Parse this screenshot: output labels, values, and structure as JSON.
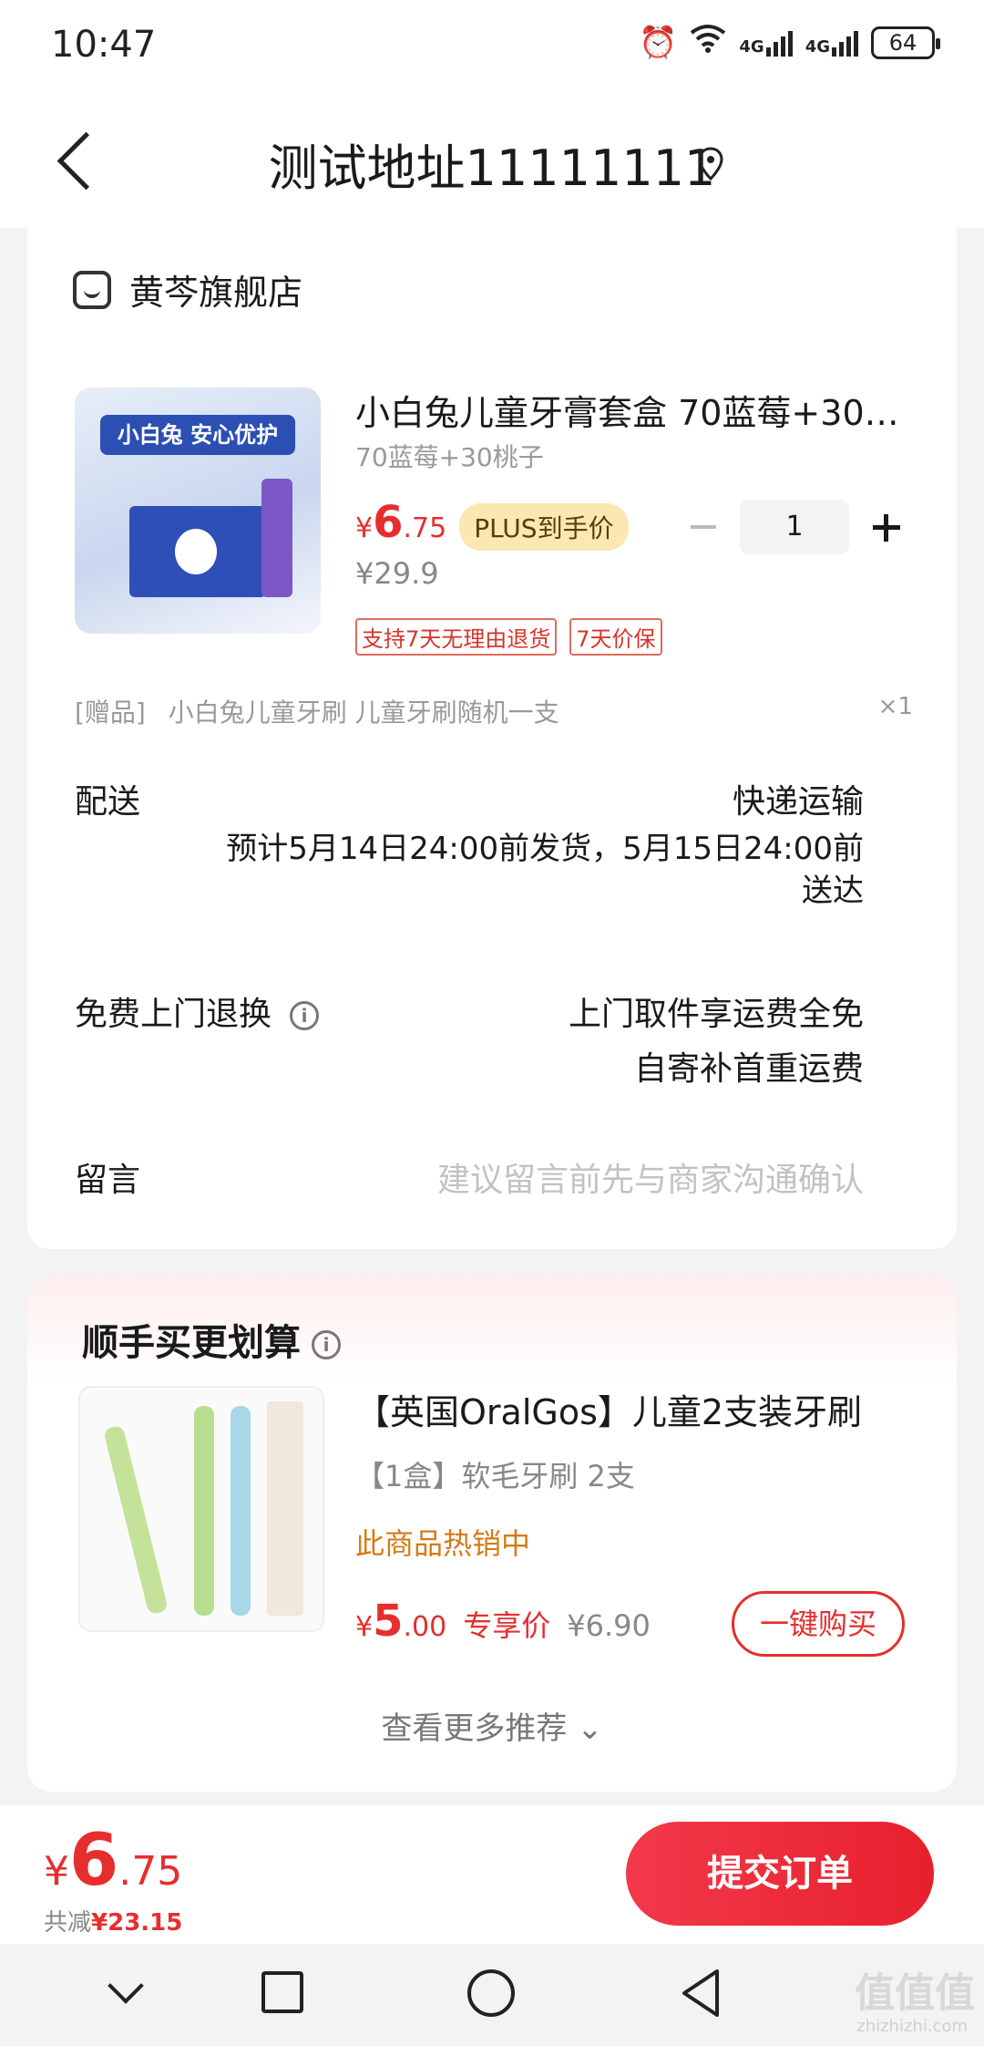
{
  "status_bar": {
    "time": "10:47",
    "network1": "4G",
    "network2": "4G",
    "battery": "64"
  },
  "header": {
    "title": "测试地址11111111"
  },
  "store": {
    "name": "黄芩旗舰店"
  },
  "product": {
    "image_banner": "小白兔 安心优护",
    "title": "小白兔儿童牙膏套盒 70蓝莓+30…",
    "variant": "70蓝莓+30桃子",
    "price_symbol": "¥",
    "price_int": "6",
    "price_dec": ".75",
    "plus_badge": "PLUS到手价",
    "original_price": "¥29.9",
    "quantity": "1",
    "tags": [
      "支持7天无理由退货",
      "7天价保"
    ]
  },
  "gift": {
    "label": "[赠品]",
    "text": "小白兔儿童牙刷 儿童牙刷随机一支",
    "qty": "×1"
  },
  "delivery": {
    "label": "配送",
    "method": "快递运输",
    "eta_line1": "预计5月14日24:00前发货，5月15日24:00前",
    "eta_line2": "送达"
  },
  "return_service": {
    "label": "免费上门退换",
    "info": "i",
    "line1": "上门取件享运费全免",
    "line2": "自寄补首重运费"
  },
  "remark": {
    "label": "留言",
    "placeholder": "建议留言前先与商家沟通确认"
  },
  "recommend": {
    "title": "顺手买更划算",
    "info": "i",
    "item_name": "【英国OralGos】儿童2支装牙刷",
    "item_spec": "【1盒】软毛牙刷 2支",
    "item_hot": "此商品热销中",
    "price_symbol": "¥",
    "price_int": "5",
    "price_dec": ".00",
    "exclusive_label": "专享价",
    "orig_price": "¥6.90",
    "buy_button": "一键购买",
    "see_more": "查看更多推荐 ⌄"
  },
  "bottom_bar": {
    "price_symbol": "¥",
    "total_int": "6",
    "total_dec": ".75",
    "discount_label": "共减",
    "discount_value": "¥23.15",
    "submit": "提交订单"
  },
  "watermark": {
    "main": "值值值",
    "sub": "zhizhizhi.com"
  },
  "colors": {
    "accent": "#e62e2e",
    "plus_badge_bg": "#fbe7b0",
    "hot": "#d67a15"
  }
}
